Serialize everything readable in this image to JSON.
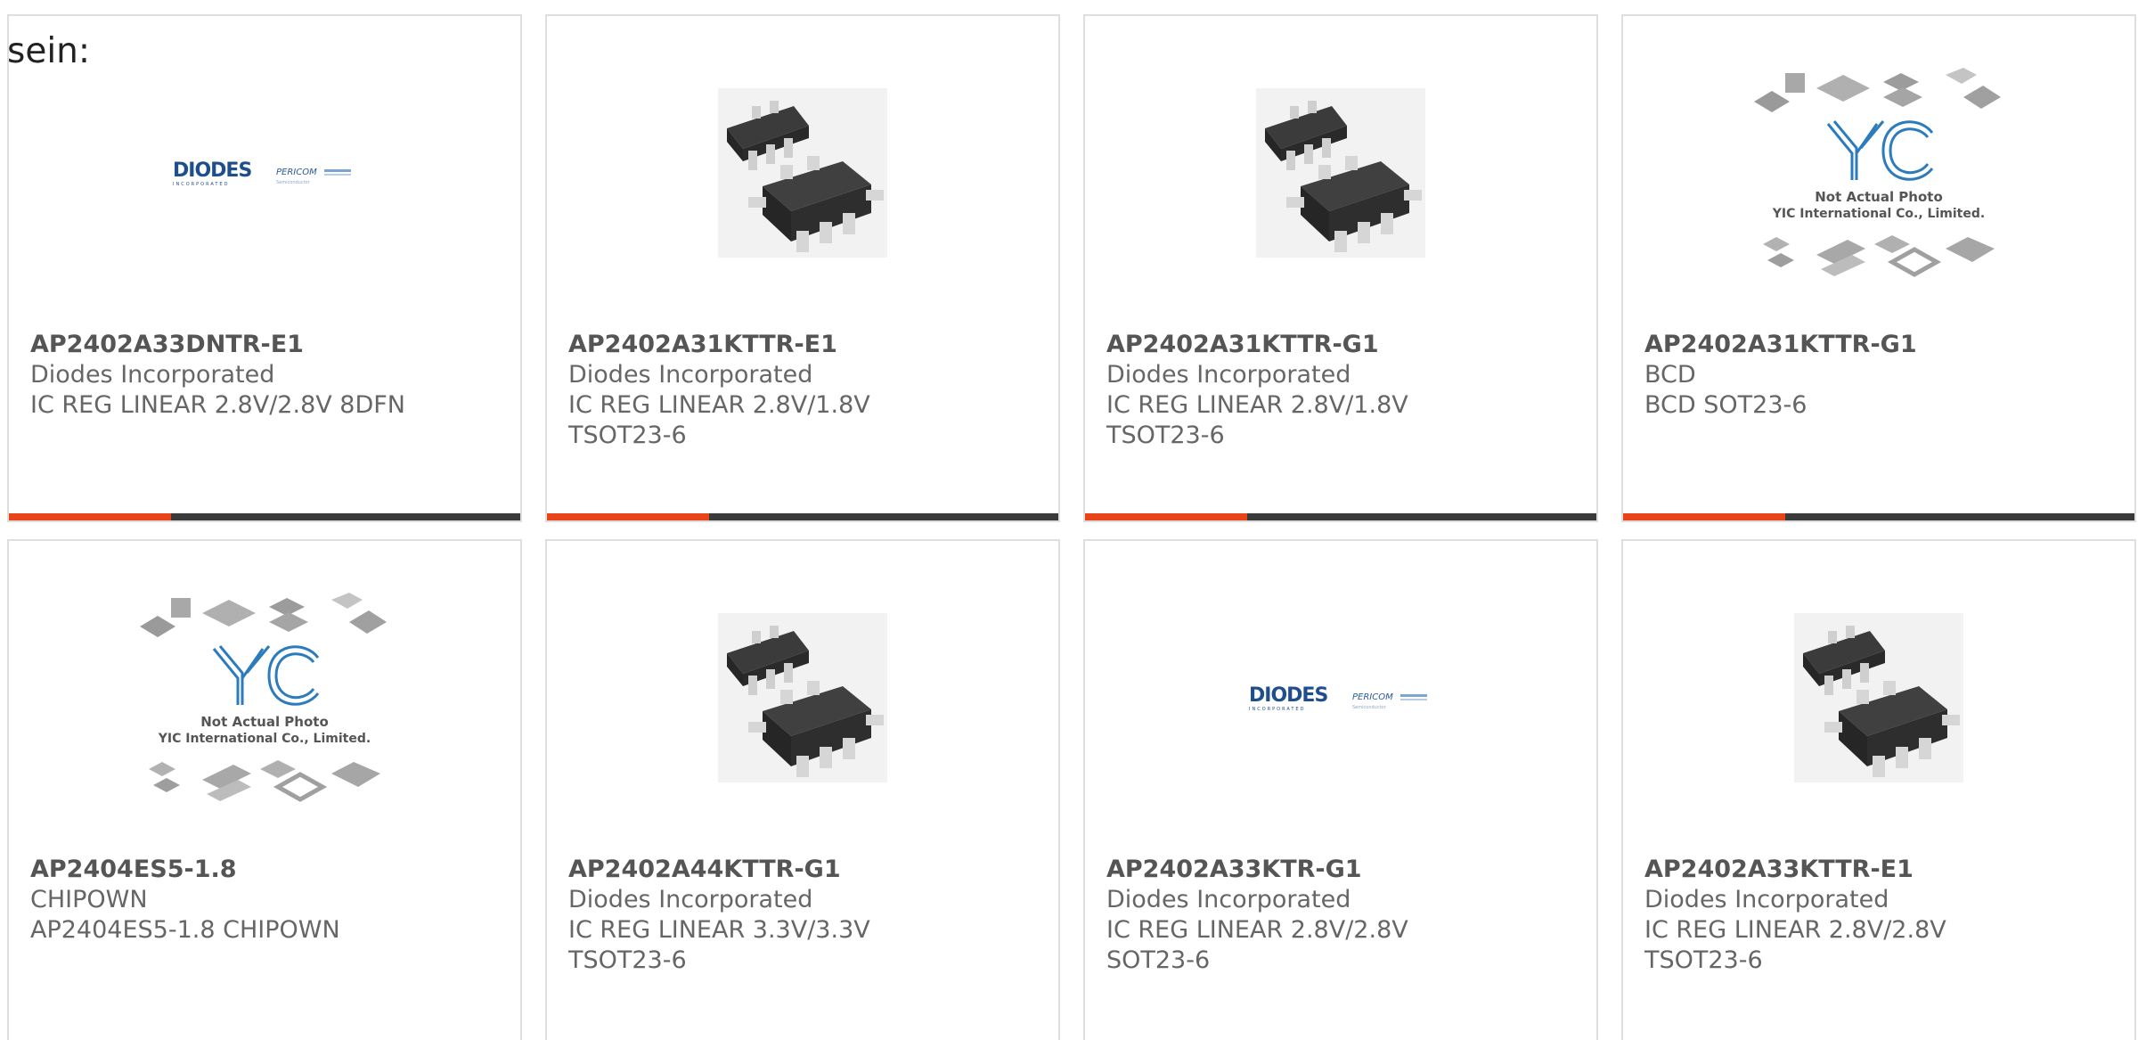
{
  "lead_text": "sein:",
  "colors": {
    "accent": "#e8441a",
    "bar_dark": "#3a3a3a",
    "card_border": "#dedede",
    "text": "#666666"
  },
  "products": [
    {
      "part": "AP2402A33DNTR-E1",
      "maker": "Diodes Incorporated",
      "desc": "IC REG LINEAR 2.8V/2.8V 8DFN",
      "image": "diodes-logo"
    },
    {
      "part": "AP2402A31KTTR-E1",
      "maker": "Diodes Incorporated",
      "desc": "IC REG LINEAR 2.8V/1.8V TSOT23-6",
      "image": "sot23-6-chip"
    },
    {
      "part": "AP2402A31KTTR-G1",
      "maker": "Diodes Incorporated",
      "desc": "IC REG LINEAR 2.8V/1.8V TSOT23-6",
      "image": "sot23-6-chip"
    },
    {
      "part": "AP2402A31KTTR-G1",
      "maker": "BCD",
      "desc": "BCD SOT23-6",
      "image": "yic-placeholder"
    },
    {
      "part": "AP2404ES5-1.8",
      "maker": "CHIPOWN",
      "desc": "AP2404ES5-1.8 CHIPOWN",
      "image": "yic-placeholder"
    },
    {
      "part": "AP2402A44KTTR-G1",
      "maker": "Diodes Incorporated",
      "desc": "IC REG LINEAR 3.3V/3.3V TSOT23-6",
      "image": "sot23-6-chip"
    },
    {
      "part": "AP2402A33KTR-G1",
      "maker": "Diodes Incorporated",
      "desc": "IC REG LINEAR 2.8V/2.8V SOT23-6",
      "image": "diodes-logo"
    },
    {
      "part": "AP2402A33KTTR-E1",
      "maker": "Diodes Incorporated",
      "desc": "IC REG LINEAR 2.8V/2.8V TSOT23-6",
      "image": "sot23-6-chip"
    }
  ],
  "logo_text": {
    "diodes": "DIODES",
    "diodes_sub": "INCORPORATED",
    "pericom": "PERICOM",
    "pericom_sub": "Semiconductor"
  },
  "placeholder": {
    "brand": "YIC",
    "line1": "Not Actual Photo",
    "line2": "YIC International Co., Limited."
  }
}
